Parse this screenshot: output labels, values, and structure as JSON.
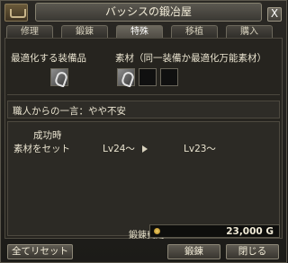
{
  "window": {
    "title": "バッシスの鍛冶屋",
    "close_label": "X"
  },
  "tabs": [
    {
      "label": "修理",
      "active": false
    },
    {
      "label": "鍛錬",
      "active": false
    },
    {
      "label": "特殊",
      "active": true
    },
    {
      "label": "移植",
      "active": false
    },
    {
      "label": "購入",
      "active": false
    }
  ],
  "optimize": {
    "equipment_label": "最適化する装備品",
    "material_label": "素材（同一装備か最適化万能素材）"
  },
  "craftsman": {
    "comment": "職人からの一言：やや不安"
  },
  "result": {
    "header": "成功時",
    "row_label": "素材をセット",
    "level_from": "Lv24～",
    "level_to": "Lv23～"
  },
  "footer": {
    "cost_label": "鍛錬費用",
    "cost_value": "23,000 G",
    "reset_button": "全てリセット",
    "forge_button": "鍛錬",
    "close_button": "閉じる"
  },
  "icons": [
    "anvil-icon",
    "close-icon",
    "equipment-item-icon",
    "gold-coin-icon",
    "arrow-right-icon"
  ]
}
